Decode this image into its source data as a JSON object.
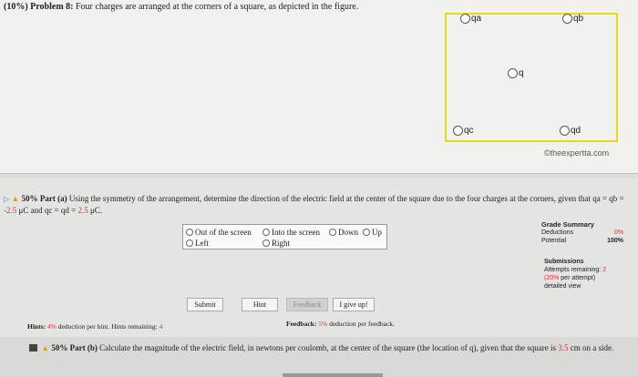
{
  "problem": {
    "weight": "(10%)",
    "label": "Problem 8:",
    "text": "Four charges are arranged at the corners of a square, as depicted in the figure."
  },
  "figure": {
    "charges": [
      {
        "label": "qa"
      },
      {
        "label": "qb"
      },
      {
        "label": "q"
      },
      {
        "label": "qc"
      },
      {
        "label": "qd"
      }
    ],
    "copyright": "©theexpertta.com",
    "border_color": "#e8d81a"
  },
  "part_a": {
    "weight": "50%",
    "label": "Part (a)",
    "text_start": "Using the symmetry of the arrangement, determine the direction of the electric field at the center of the square due to the four charges at the corners, given that",
    "given_1": "qa = qb = ",
    "value_1": "-2.5",
    "given_2": " μC and qc = qd = ",
    "value_2": "2.5",
    "unit_end": " μC."
  },
  "options": [
    {
      "label": "Out of the screen"
    },
    {
      "label": "Into the screen"
    },
    {
      "label": "Down"
    },
    {
      "label": "Up"
    },
    {
      "label": "Left"
    },
    {
      "label": "Right"
    }
  ],
  "grade_summary": {
    "title": "Grade Summary",
    "deductions_label": "Deductions",
    "deductions_value": "0%",
    "potential_label": "Potential",
    "potential_value": "100%"
  },
  "submissions": {
    "title": "Submissions",
    "attempts_label": "Attempts remaining:",
    "attempts_value": "2",
    "per_attempt_pct": "(20%",
    "per_attempt_text": " per attempt)",
    "detailed_view": "detailed view"
  },
  "buttons": {
    "submit": "Submit",
    "hint": "Hint",
    "feedback": "Feedback",
    "give_up": "I give up!"
  },
  "hints": {
    "label": "Hints:",
    "pct": "4%",
    "text": " deduction per hint. Hints remaining:",
    "remaining": "4"
  },
  "feedback": {
    "label": "Feedback:",
    "pct": "5%",
    "text": " deduction per feedback."
  },
  "part_b": {
    "weight": "50%",
    "label": "Part (b)",
    "text": "Calculate the magnitude of the electric field, in newtons per coulomb, at the center of the square (the location of q), given that the square is",
    "value": "3.5",
    "text_end": " cm on a side."
  }
}
